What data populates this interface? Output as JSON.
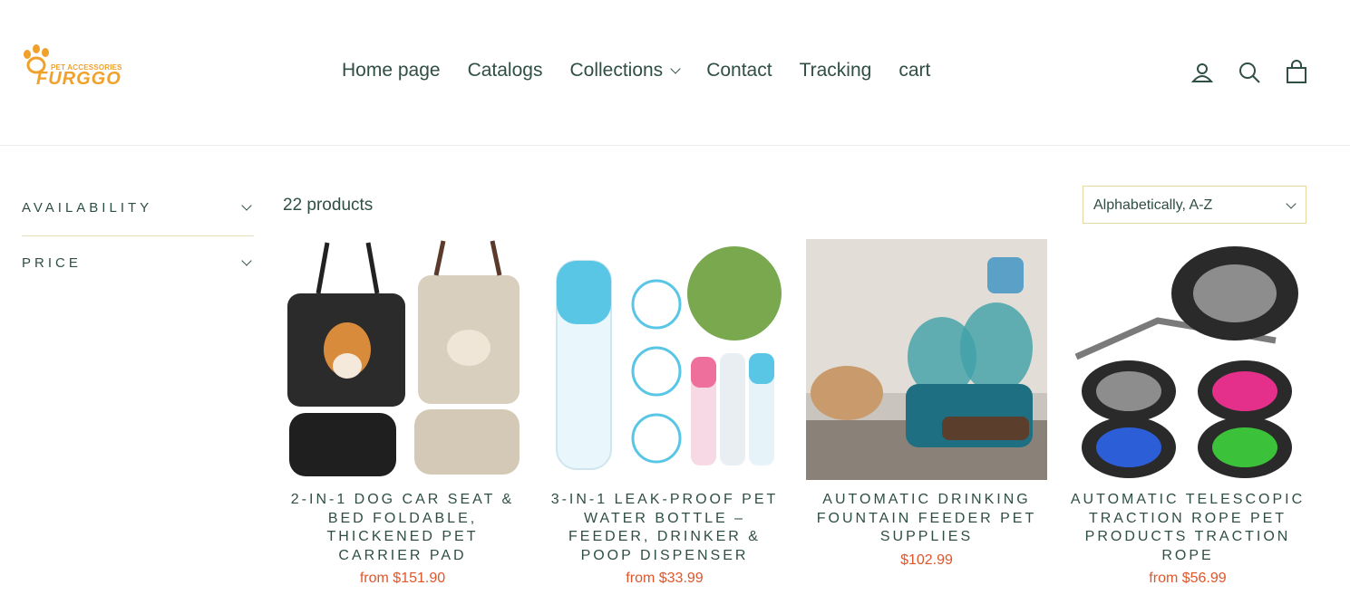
{
  "brand": {
    "sub": "PET ACCESSORIES",
    "name": "FURGGO",
    "color": "#f0a12a"
  },
  "nav": {
    "items": [
      {
        "label": "Home page"
      },
      {
        "label": "Catalogs"
      },
      {
        "label": "Collections"
      },
      {
        "label": "Contact"
      },
      {
        "label": "Tracking"
      },
      {
        "label": "cart"
      }
    ],
    "icons": [
      "user-icon",
      "search-icon",
      "cart-icon"
    ]
  },
  "filters": {
    "availability": "AVAILABILITY",
    "price": "PRICE"
  },
  "collection": {
    "count": "22 products",
    "sort": "Alphabetically, A-Z"
  },
  "products": [
    {
      "title": "2-in-1 Dog Car Seat & Bed Foldable, Thickened Pet Carrier Pad",
      "price": "from $151.90"
    },
    {
      "title": "3-in-1 Leak-Proof Pet Water Bottle – Feeder, Drinker & Poop Dispenser",
      "price": "from $33.99"
    },
    {
      "title": "Automatic Drinking Fountain Feeder Pet Supplies",
      "price": "$102.99"
    },
    {
      "title": "Automatic Telescopic Traction Rope Pet Products Traction Rope",
      "price": "from $56.99"
    }
  ],
  "colors": {
    "text": "#2f4f43",
    "price": "#e0562b",
    "accent_border": "#e6d9a0"
  }
}
